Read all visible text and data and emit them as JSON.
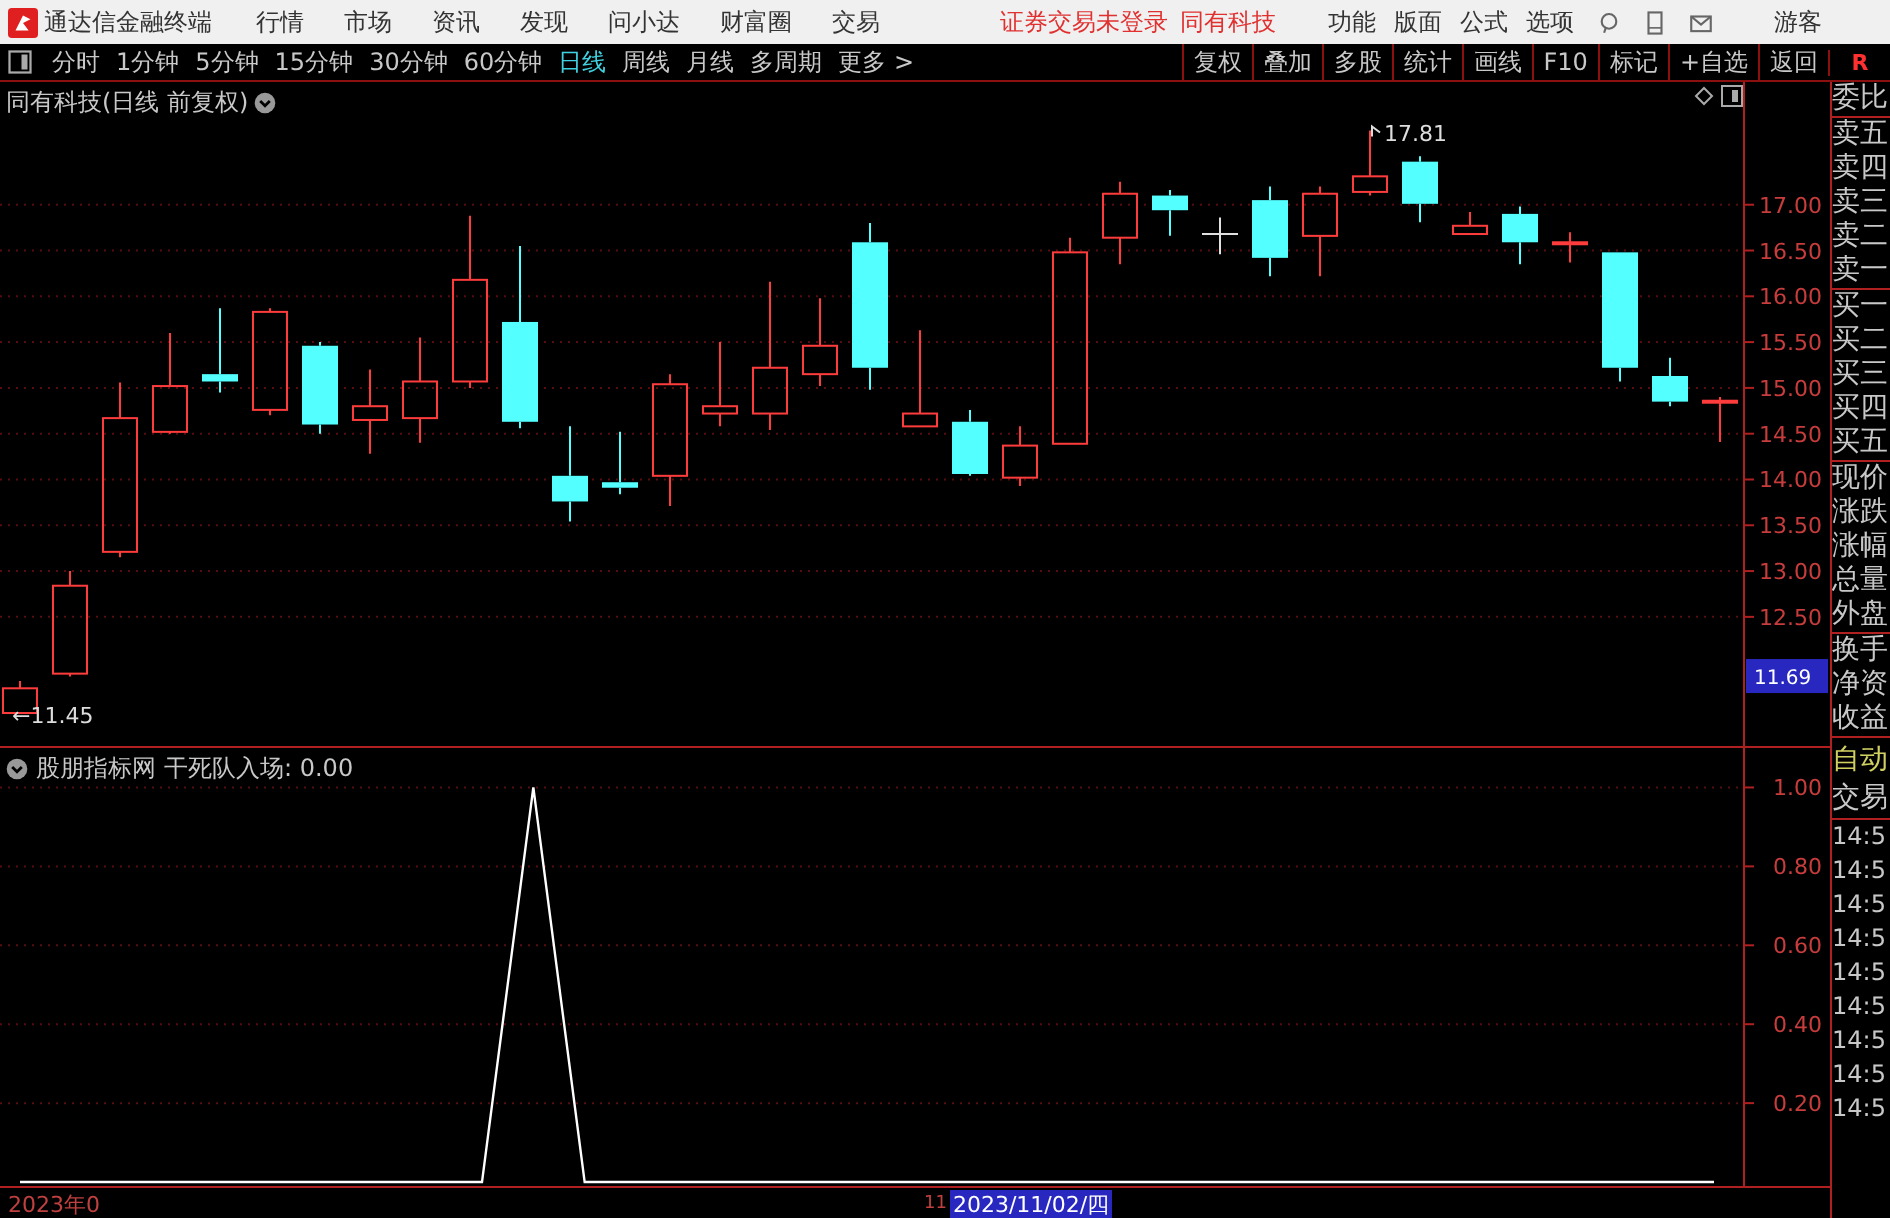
{
  "app": {
    "title": "通达信金融终端",
    "menu": [
      "行情",
      "市场",
      "资讯",
      "发现",
      "问小达",
      "财富圈",
      "交易"
    ],
    "notice": "证券交易未登录",
    "stock_link": "同有科技",
    "tools": [
      "功能",
      "版面",
      "公式",
      "选项"
    ],
    "user": "游客"
  },
  "periods": [
    {
      "label": "分时",
      "selected": false
    },
    {
      "label": "1分钟",
      "selected": false
    },
    {
      "label": "5分钟",
      "selected": false
    },
    {
      "label": "15分钟",
      "selected": false
    },
    {
      "label": "30分钟",
      "selected": false
    },
    {
      "label": "60分钟",
      "selected": false
    },
    {
      "label": "日线",
      "selected": true
    },
    {
      "label": "周线",
      "selected": false
    },
    {
      "label": "月线",
      "selected": false
    },
    {
      "label": "多周期",
      "selected": false
    },
    {
      "label": "更多 >",
      "selected": false
    }
  ],
  "actions": [
    "复权",
    "叠加",
    "多股",
    "统计",
    "画线",
    "F10",
    "标记",
    "+自选",
    "返回"
  ],
  "corner": "R",
  "price_panel": {
    "title": "同有科技(日线 前复权)",
    "high_label": "17.81",
    "low_label": "←11.45",
    "cursor_price": "11.69",
    "chart_data": {
      "type": "candlestick",
      "yticks": [
        {
          "value": 12.5,
          "label": "12.50"
        },
        {
          "value": 13,
          "label": "13.00"
        },
        {
          "value": 13.5,
          "label": "13.50"
        },
        {
          "value": 14,
          "label": "14.00"
        },
        {
          "value": 14.5,
          "label": "14.50"
        },
        {
          "value": 15,
          "label": "15.00"
        },
        {
          "value": 15.5,
          "label": "15.50"
        },
        {
          "value": 16,
          "label": "16.00"
        },
        {
          "value": 16.5,
          "label": "16.50"
        },
        {
          "value": 17,
          "label": "17.00"
        }
      ],
      "ylim": [
        11.09,
        18.34
      ],
      "grid": true,
      "series": [
        {
          "ohlc": [
            [
              11.45,
              11.8,
              11.45,
              11.72
            ],
            [
              11.88,
              13.0,
              11.85,
              12.84
            ],
            [
              13.21,
              15.06,
              13.15,
              14.67
            ],
            [
              14.52,
              15.6,
              14.5,
              15.02
            ],
            [
              15.15,
              15.87,
              14.95,
              15.07
            ],
            [
              14.76,
              15.87,
              14.7,
              15.83
            ],
            [
              15.46,
              15.5,
              14.5,
              14.6
            ],
            [
              14.65,
              15.2,
              14.28,
              14.8
            ],
            [
              14.67,
              15.55,
              14.4,
              15.07
            ],
            [
              15.07,
              16.88,
              15.0,
              16.18
            ],
            [
              15.72,
              16.55,
              14.56,
              14.63
            ],
            [
              14.04,
              14.58,
              13.54,
              13.76
            ],
            [
              13.97,
              14.52,
              13.84,
              13.91
            ],
            [
              14.04,
              15.15,
              13.71,
              15.04
            ],
            [
              14.72,
              15.5,
              14.58,
              14.8
            ],
            [
              14.72,
              16.16,
              14.54,
              15.22
            ],
            [
              15.15,
              15.98,
              15.02,
              15.46
            ],
            [
              16.59,
              16.8,
              14.98,
              15.22
            ],
            [
              14.58,
              15.63,
              14.58,
              14.72
            ],
            [
              14.63,
              14.76,
              14.04,
              14.06
            ],
            [
              14.02,
              14.58,
              13.93,
              14.37
            ],
            [
              14.39,
              16.64,
              14.39,
              16.48
            ],
            [
              16.64,
              17.25,
              16.35,
              17.12
            ],
            [
              17.1,
              17.16,
              16.66,
              16.94
            ],
            [
              16.68,
              16.86,
              16.46,
              16.68
            ],
            [
              17.05,
              17.2,
              16.22,
              16.42
            ],
            [
              16.66,
              17.2,
              16.22,
              17.12
            ],
            [
              17.14,
              17.81,
              17.1,
              17.31
            ],
            [
              17.47,
              17.53,
              16.81,
              17.01
            ],
            [
              16.68,
              16.92,
              16.68,
              16.77
            ],
            [
              16.9,
              16.98,
              16.35,
              16.59
            ],
            [
              16.57,
              16.7,
              16.37,
              16.59
            ],
            [
              16.48,
              16.48,
              15.07,
              15.22
            ],
            [
              15.13,
              15.33,
              14.8,
              14.85
            ],
            [
              14.85,
              14.9,
              14.41,
              14.86
            ]
          ]
        }
      ]
    }
  },
  "indicator_panel": {
    "source": "股朋指标网",
    "reading": "干死队入场: 0.00",
    "chart_data": {
      "type": "line",
      "ylim": [
        -0.01,
        1.1
      ],
      "grid": true,
      "yticks": [
        {
          "value": 0.2,
          "label": "0.20"
        },
        {
          "value": 0.4,
          "label": "0.40"
        },
        {
          "value": 0.6,
          "label": "0.60"
        },
        {
          "value": 0.8,
          "label": "0.80"
        },
        {
          "value": 1,
          "label": "1.00"
        }
      ],
      "series": [
        {
          "color": "#ffffff",
          "values": [
            0,
            0,
            0,
            0,
            0,
            0,
            0,
            0,
            0,
            0,
            1,
            0,
            0,
            0,
            0,
            0,
            0,
            0,
            0,
            0,
            0,
            0,
            0,
            0,
            0,
            0,
            0,
            0,
            0,
            0,
            0,
            0,
            0,
            0
          ]
        }
      ]
    }
  },
  "time_axis": {
    "start": "2023年0",
    "cursor_day": "11",
    "cursor_date": "2023/11/02/四"
  },
  "quote_panel": {
    "groups": [
      [
        "委比"
      ],
      [
        "卖五",
        "卖四",
        "卖三",
        "卖二",
        "卖一"
      ],
      [
        "买一",
        "买二",
        "买三",
        "买四",
        "买五"
      ],
      [
        "现价",
        "涨跌",
        "涨幅",
        "总量",
        "外盘"
      ],
      [
        "换手",
        "净资",
        "收益"
      ]
    ],
    "mode": "自动",
    "trade": "交易",
    "times": [
      "14:5",
      "14:5",
      "14:5",
      "14:5",
      "14:5",
      "14:5",
      "14:5",
      "14:5",
      "14:5"
    ]
  }
}
